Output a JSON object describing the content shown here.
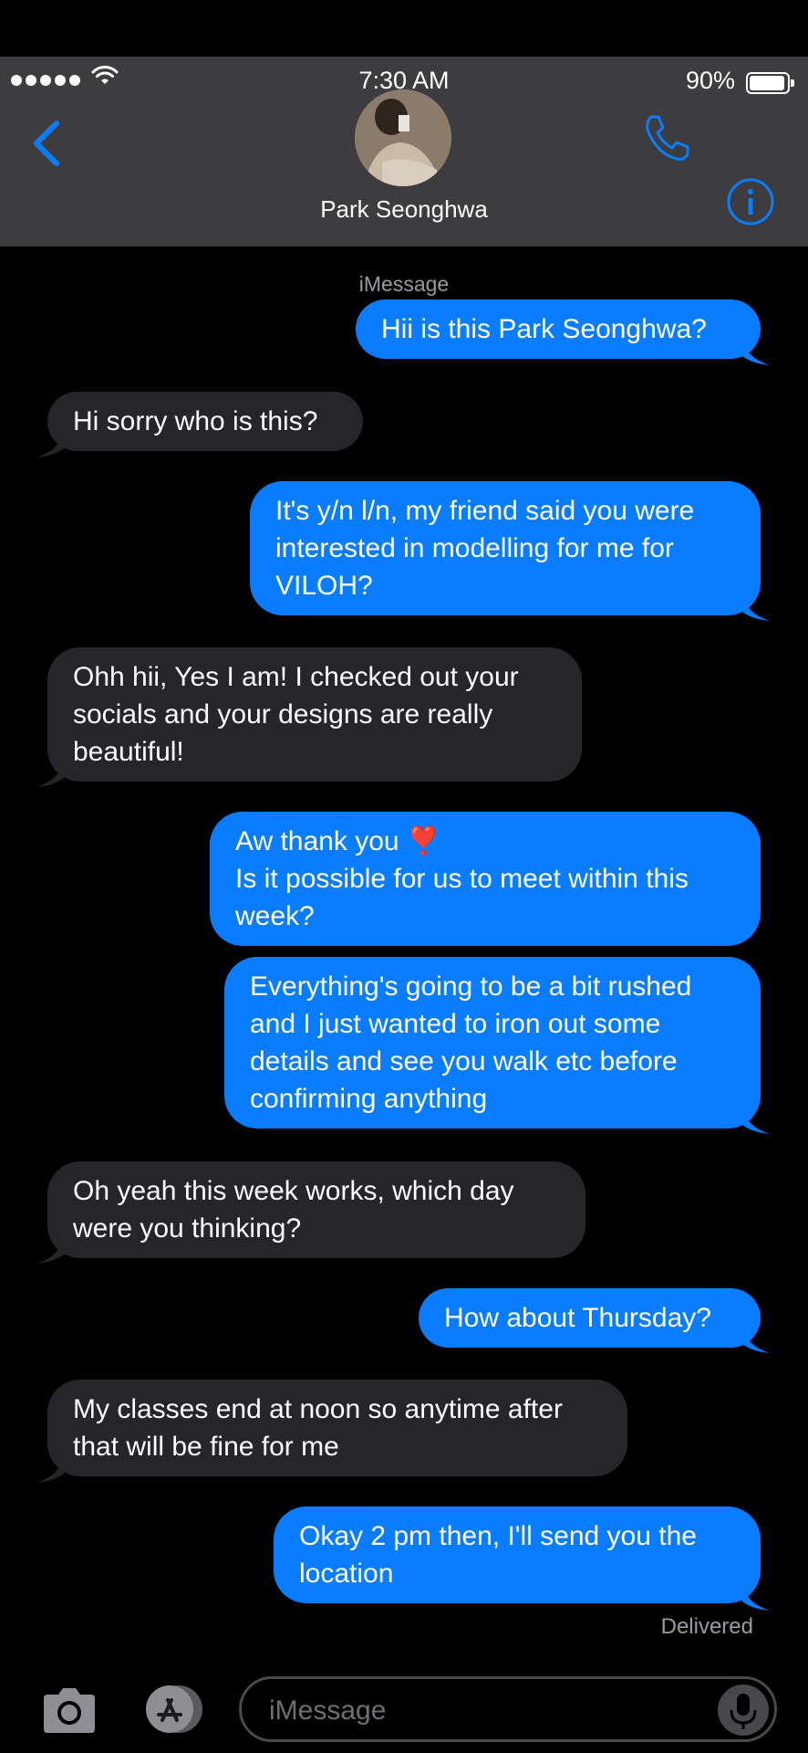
{
  "status_bar": {
    "time": "7:30 AM",
    "battery": "90%"
  },
  "header": {
    "contact_name": "Park Seonghwa"
  },
  "service_label": "iMessage",
  "messages": [
    {
      "sender": "me",
      "text": "Hii is this Park Seonghwa?"
    },
    {
      "sender": "them",
      "text": "Hi sorry who is this?"
    },
    {
      "sender": "me",
      "text": "It's y/n l/n, my friend said you were\ninterested in modelling for me for\nVILOH?"
    },
    {
      "sender": "them",
      "text": "Ohh hii, Yes I am! I checked out your\nsocials and your designs are really\nbeautiful!"
    },
    {
      "sender": "me",
      "text": "Aw thank you ❣️\nIs it possible for us to meet within this\nweek?"
    },
    {
      "sender": "me",
      "text": "Everything's going to be a bit rushed\nand I just wanted to iron out some\ndetails and see you walk etc before\nconfirming anything"
    },
    {
      "sender": "them",
      "text": "Oh yeah this week works, which day\nwere you thinking?"
    },
    {
      "sender": "me",
      "text": "How about Thursday?"
    },
    {
      "sender": "them",
      "text": "My classes end at noon so anytime after\nthat will be fine for me"
    },
    {
      "sender": "me",
      "text": "Okay 2 pm then, I'll send you the\nlocation"
    }
  ],
  "delivered_label": "Delivered",
  "input": {
    "placeholder": "iMessage"
  },
  "colors": {
    "sent_bubble": "#0a7cff",
    "received_bubble": "#26252a",
    "header_bg": "#3d3d3f",
    "accent": "#0a7cff"
  }
}
